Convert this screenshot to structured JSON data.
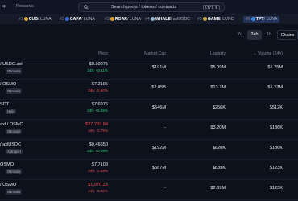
{
  "nav": {
    "link1": "ap",
    "link2": "Rewards"
  },
  "search": {
    "placeholder": "Search pools / tokens / contracts",
    "shortcut": "Ctrl K"
  },
  "ticker": [
    {
      "rank": "#1",
      "symbol": "CUB",
      "pair": "/ LUNA",
      "dot": "#d8a43a",
      "highlight": false
    },
    {
      "rank": "#2",
      "symbol": "CAPA",
      "pair": "/ LUNA",
      "dot": "#3d6fd8",
      "highlight": false
    },
    {
      "rank": "#3",
      "symbol": "ROAR",
      "pair": "/ LUNA",
      "dot": "#d79b2d",
      "highlight": false
    },
    {
      "rank": "#4",
      "symbol": "WHALE",
      "pair": "/ axlUSDC",
      "dot": "#8fb0c9",
      "highlight": false
    },
    {
      "rank": "#5",
      "symbol": "GAME",
      "pair": "/ LUNC",
      "dot": "#caa548",
      "highlight": false
    },
    {
      "rank": "#6",
      "symbol": "TPT",
      "pair": "/ LUNA",
      "dot": "#3f8ad8",
      "highlight": true
    }
  ],
  "timeframes": [
    "7d",
    "24h",
    "1h"
  ],
  "selected_timeframe": "24h",
  "chains_label": "Chains",
  "columns": {
    "price": "Price",
    "mcap": "Market Cap",
    "liquidity": "Liquidity",
    "volume": "Volume (24h)"
  },
  "rows": [
    {
      "pool": "/ USDC.axl",
      "tag": "Osmosis",
      "price": "$0.30075",
      "change": "24h: +0.11%",
      "dir": "up",
      "mcap": "$191M",
      "liq": "$5.09M",
      "vol": "$1.25M"
    },
    {
      "pool": "/ OSMO",
      "tag": "Osmosis",
      "price": "$7.2195",
      "change": "24h: -2.60%",
      "dir": "down",
      "mcap": "$2.05B",
      "liq": "$13.7M",
      "vol": "$1.23M"
    },
    {
      "pool": "SDT",
      "tag": "Helix",
      "price": "$7.6976",
      "change": "24h: +5.05%",
      "dir": "up",
      "mcap": "$546M",
      "liq": "$256K",
      "vol": "$512K"
    },
    {
      "pool": "axl / OSMO",
      "tag": "Osmosis",
      "price": "$27,703.84",
      "change": "24h: -0.75%",
      "dir": "down",
      "mcap": "-",
      "liq": "$3.20M",
      "vol": "$186K"
    },
    {
      "pool": "/ axlUSDC",
      "tag": "Astroport",
      "price": "$0.46650",
      "change": "24h: +0.08%",
      "dir": "up",
      "mcap": "$192M",
      "liq": "$820K",
      "vol": "$186K"
    },
    {
      "pool": "OSMO",
      "tag": "Osmosis",
      "price": "$7.7108",
      "change": "24h: -2.58%",
      "dir": "down",
      "mcap": "$567M",
      "liq": "$839K",
      "vol": "$123K"
    },
    {
      "pool": "/ OSMO",
      "tag": "Osmosis",
      "price": "$1,070.23",
      "change": "24h: -3.05%",
      "dir": "down",
      "mcap": "-",
      "liq": "$2.89M",
      "vol": "$123K"
    }
  ],
  "colors": {
    "up": "#2fd17a",
    "down": "#ef5050",
    "accent": "#24325a"
  }
}
